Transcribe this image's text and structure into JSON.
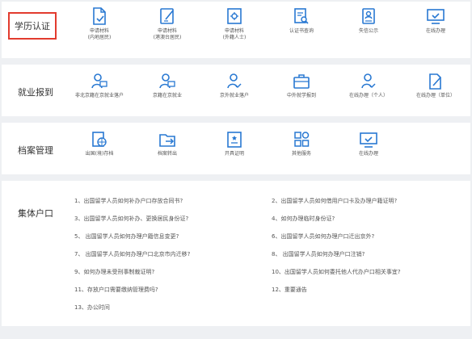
{
  "categories": {
    "education": "学历认证",
    "employment": "就业报到",
    "archives": "档案管理",
    "household": "集体户口"
  },
  "education_items": [
    {
      "icon": "document-check-icon",
      "label_line1": "申请材料",
      "label_line2": "(内地居民)"
    },
    {
      "icon": "document-edit-icon",
      "label_line1": "申请材料",
      "label_line2": "(港澳台居民)"
    },
    {
      "icon": "document-gear-icon",
      "label_line1": "申请材料",
      "label_line2": "(外籍人士)"
    },
    {
      "icon": "document-search-icon",
      "label_line1": "认证书查询",
      "label_line2": ""
    },
    {
      "icon": "id-badge-icon",
      "label_line1": "失信公示",
      "label_line2": ""
    },
    {
      "icon": "monitor-check-icon",
      "label_line1": "在线办理",
      "label_line2": ""
    }
  ],
  "employment_items": [
    {
      "icon": "person-card-icon",
      "label": "非北京籍在京就业落户"
    },
    {
      "icon": "person-card-icon",
      "label": "京籍在京就业"
    },
    {
      "icon": "person-check-icon",
      "label": "京外就业落户"
    },
    {
      "icon": "briefcase-icon",
      "label": "中外就学报到"
    },
    {
      "icon": "person-check-icon",
      "label": "在线办理（个人）"
    },
    {
      "icon": "document-edit-icon",
      "label": "在线办理（单位）"
    }
  ],
  "archive_items": [
    {
      "icon": "globe-document-icon",
      "label": "出国(境)存档"
    },
    {
      "icon": "folder-out-icon",
      "label": "档案转出"
    },
    {
      "icon": "certificate-icon",
      "label": "开具证明"
    },
    {
      "icon": "grid-services-icon",
      "label": "其他服务"
    },
    {
      "icon": "monitor-check-icon",
      "label": "在线办理"
    }
  ],
  "household_links_left": [
    "1、出国留学人员如何补办户口存放合同书?",
    "3、出国留学人员如何补办、更换居民身份证?",
    "5、 出国留学人员如何办理户籍信息变更?",
    "7、 出国留学人员如何办理户口北京市内迁移?",
    "9、如何办理未受刑事制裁证明?",
    "11、存放户口需要缴纳管理费吗?",
    "13、办公时间"
  ],
  "household_links_right": [
    "2、出国留学人员如何借用户口卡及办理户籍证明?",
    "4、如何办理临时身份证?",
    "6、出国留学人员如何办理户口迁出京外?",
    "8、 出国留学人员如何办理户口注销?",
    "10、出国留学人员如何委托他人代办户口相关事宜?",
    "12、重要通告"
  ],
  "colors": {
    "accent": "#2878d2",
    "highlight_border": "#e23b2e"
  }
}
